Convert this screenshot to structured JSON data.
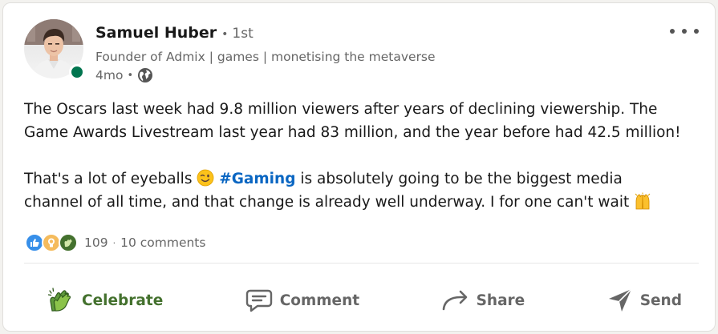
{
  "post": {
    "author": {
      "name": "Samuel Huber",
      "degree": "1st",
      "headline": "Founder of Admix | games | monetising the metaverse",
      "posted_ago": "4mo",
      "visibility_icon": "globe-icon",
      "online_status": "online"
    },
    "menu_icon": "more-icon",
    "body": {
      "line1": "The Oscars last week had 9.8 million viewers after years of declining viewership. The",
      "line2": "Game Awards Livestream last year had 83 million, and the year before had 42.5 million!",
      "line3_before": "That's a lot of eyeballs",
      "line3_emoji": "winking-face-emoji",
      "hashtag": "#Gaming",
      "line3_after": "is absolutely going to be the biggest media",
      "line4": "channel of all time, and that change is already well underway. I for one can't wait",
      "line4_emoji": "raising-hands-emoji"
    },
    "social": {
      "reaction_icons": [
        "like-icon",
        "insightful-icon",
        "celebrate-icon"
      ],
      "reaction_count": "109",
      "separator": "·",
      "comments": "10 comments"
    },
    "actions": {
      "celebrate": "Celebrate",
      "comment": "Comment",
      "share": "Share",
      "send": "Send"
    }
  },
  "colors": {
    "link": "#0a66c2",
    "celebrate_green": "#44712e",
    "online_green": "#01754f",
    "secondary_text": "#666666",
    "primary_text": "#191919"
  }
}
